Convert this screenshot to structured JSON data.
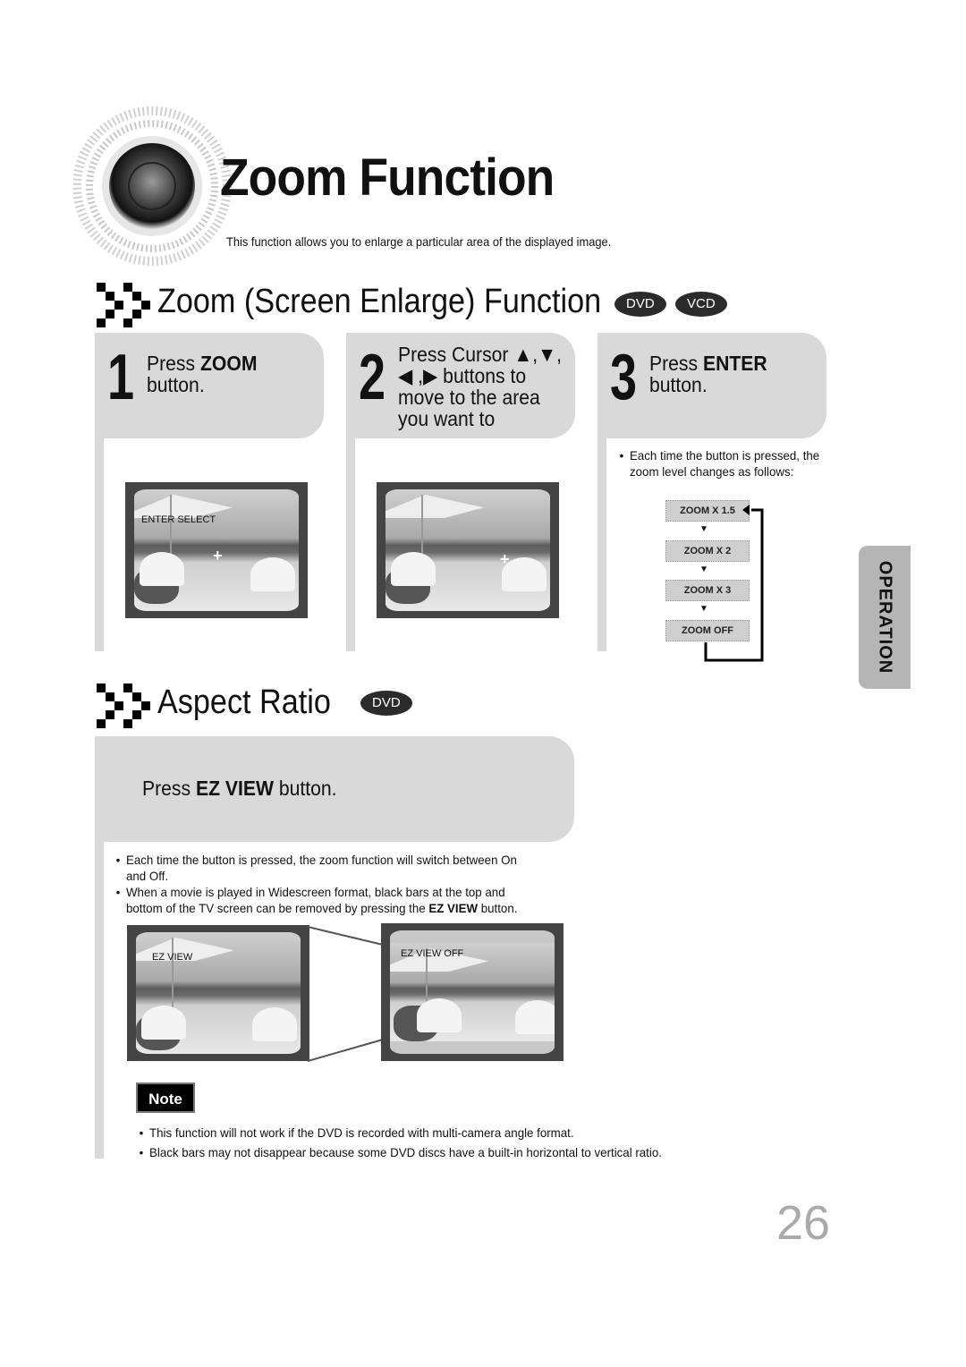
{
  "header": {
    "title": "Zoom Function",
    "subtitle": "This function allows you to enlarge a particular area of the displayed image.",
    "speaker_icon": "speaker-icon"
  },
  "zoom_section": {
    "title": "Zoom (Screen Enlarge) Function",
    "badges": [
      "DVD",
      "VCD"
    ],
    "steps": [
      {
        "number": "1",
        "text_prefix": "Press ",
        "text_bold": "ZOOM",
        "text_suffix": "button.",
        "osd": "ENTER SELECT"
      },
      {
        "number": "2",
        "line1": "Press Cursor ▲,▼,",
        "line2": "◀ ,▶ buttons to",
        "line3": "move to the area",
        "line4": "you want to"
      },
      {
        "number": "3",
        "text_prefix": "Press ",
        "text_bold": "ENTER",
        "text_suffix": "button.",
        "bullet": "Each time the button is pressed, the zoom level changes as follows:",
        "bullet_line1": "Each time the button is pressed, the",
        "bullet_line2": "zoom level changes as follows:"
      }
    ],
    "zoom_levels": [
      "ZOOM X 1.5",
      "ZOOM X 2",
      "ZOOM X 3",
      "ZOOM  OFF"
    ]
  },
  "side_tab": {
    "label": "OPERATION"
  },
  "aspect_section": {
    "title": "Aspect Ratio",
    "badge": "DVD",
    "instruction_prefix": "Press ",
    "instruction_bold": "EZ VIEW",
    "instruction_suffix": " button.",
    "bullets": [
      {
        "line1": "Each time the button is pressed, the zoom function will switch between On",
        "line2": "and Off."
      },
      {
        "line1": "When a movie is played in Widescreen format, black bars at the top and",
        "line2_prefix": "bottom of the TV screen can be removed by pressing the ",
        "line2_bold": "EZ VIEW",
        "line2_suffix": " button."
      }
    ],
    "images": [
      {
        "osd": "EZ VIEW"
      },
      {
        "osd": "EZ VIEW OFF"
      }
    ]
  },
  "note": {
    "label": "Note",
    "items": [
      "This function will not work if the DVD is recorded with multi-camera angle format.",
      "Black bars may not disappear because some DVD discs have a built-in horizontal to vertical ratio."
    ]
  },
  "page_number": "26"
}
